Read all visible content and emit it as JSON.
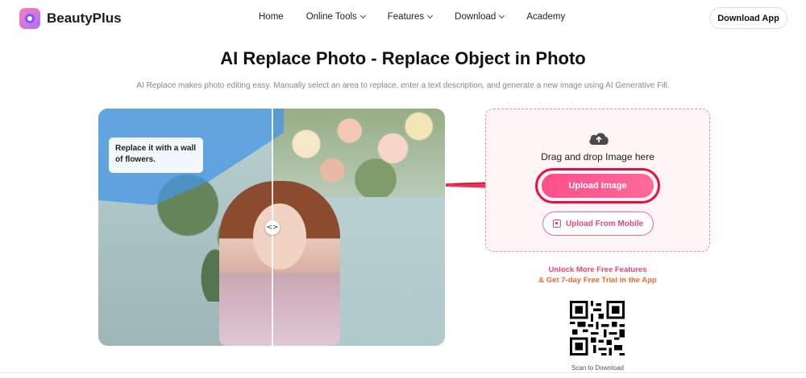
{
  "header": {
    "brand": "BeautyPlus",
    "nav": [
      {
        "label": "Home",
        "dropdown": false
      },
      {
        "label": "Online Tools",
        "dropdown": true
      },
      {
        "label": "Features",
        "dropdown": true
      },
      {
        "label": "Download",
        "dropdown": true
      },
      {
        "label": "Academy",
        "dropdown": false
      }
    ],
    "download_app": "Download App"
  },
  "main": {
    "title": "AI Replace Photo - Replace Object in Photo",
    "subtitle": "AI Replace makes photo editing easy. Manually select an area to replace, enter a text description, and generate a new image using AI Generative Fill."
  },
  "hero": {
    "prompt_line1": "Replace it with a wall",
    "prompt_line2": "of flowers.",
    "compare_handle": "<>"
  },
  "upload": {
    "drag_text": "Drag and drop Image here",
    "upload_button": "Upload Image",
    "mobile_button": "Upload From Mobile"
  },
  "promo": {
    "line1": "Unlock More Free Features",
    "line2": "& Get 7-day Free Trial in the App",
    "qr_caption": "Scan to Download"
  },
  "colors": {
    "accent": "#ff4f8a",
    "arrow": "#e8103a",
    "upload_bg": "#fff5f7"
  }
}
